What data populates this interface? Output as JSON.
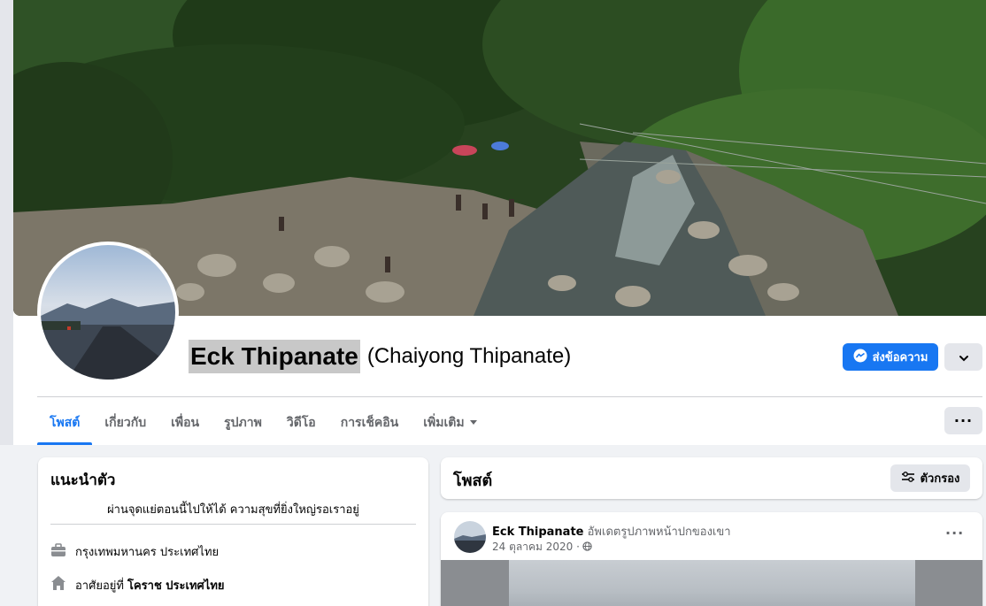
{
  "profile": {
    "name": "Eck Thipanate",
    "alternate_name": "(Chaiyong Thipanate)"
  },
  "actions": {
    "message_label": "ส่งข้อความ"
  },
  "tabs": [
    {
      "label": "โพสต์"
    },
    {
      "label": "เกี่ยวกับ"
    },
    {
      "label": "เพื่อน"
    },
    {
      "label": "รูปภาพ"
    },
    {
      "label": "วิดีโอ"
    },
    {
      "label": "การเช็คอิน"
    },
    {
      "label": "เพิ่มเติม"
    }
  ],
  "tabs_more_label": "···",
  "intro": {
    "title": "แนะนำตัว",
    "bio": "ผ่านจุดแย่ตอนนี้ไปให้ได้ ความสุขที่ยิ่งใหญ่รอเราอยู่",
    "work": "กรุงเทพมหานคร ประเทศไทย",
    "lives_prefix": "อาศัยอยู่ที่",
    "lives_place": "โคราช ประเทศไทย"
  },
  "posts": {
    "title": "โพสต์",
    "filter_label": "ตัวกรอง"
  },
  "post": {
    "author": "Eck Thipanate",
    "action": "อัพเดตรูปภาพหน้าปกของเขา",
    "date": "24 ตุลาคม 2020 ·",
    "menu_label": "···"
  },
  "colors": {
    "accent": "#1877f2",
    "background": "#f0f2f5",
    "secondary_button": "#e4e6eb",
    "muted_text": "#65676b"
  }
}
